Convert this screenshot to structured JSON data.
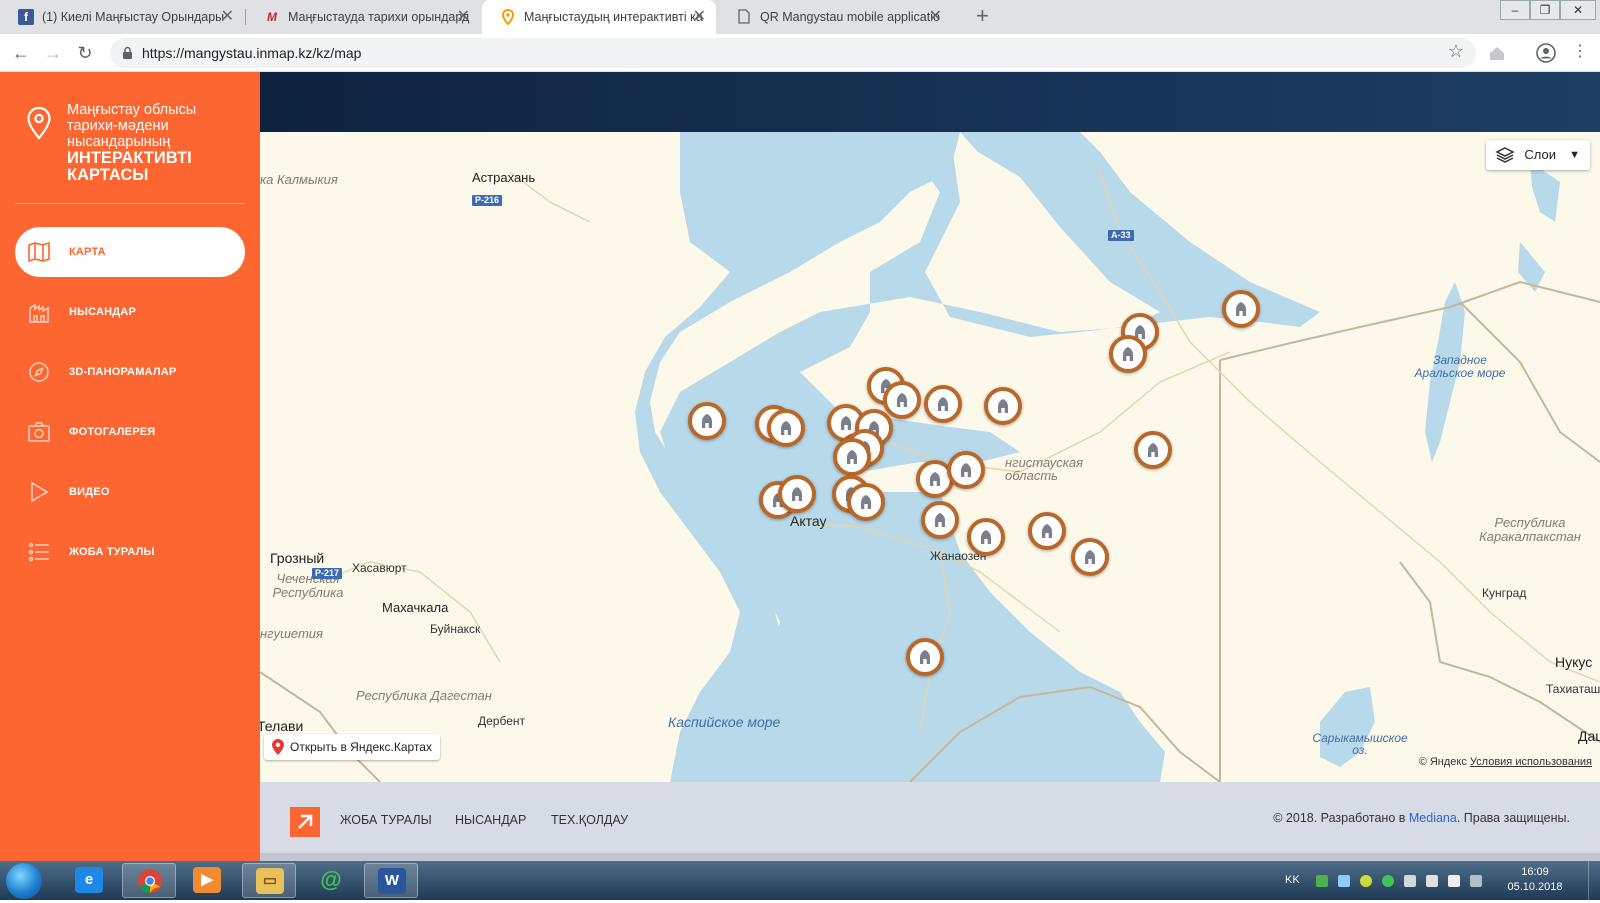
{
  "browser": {
    "tabs": [
      {
        "title": "(1) Киелі Маңғыстау Орындары",
        "favicon": "facebook-icon"
      },
      {
        "title": "Маңғыстауда тарихи орындард",
        "favicon": "m-logo-icon"
      },
      {
        "title": "Маңғыстаудың интерактивті ка",
        "favicon": "map-pin-icon"
      },
      {
        "title": "QR Mangystau mobile applicatio",
        "favicon": "document-icon"
      }
    ],
    "active_tab": 2,
    "url": "https://mangystau.inmap.kz/kz/map"
  },
  "sidebar": {
    "brand_lines": [
      "Маңғыстау облысы",
      "тарихи-мәдени",
      "нысандарының"
    ],
    "brand_strong": [
      "ИНТЕРАКТИВТІ",
      "КАРТАСЫ"
    ],
    "menu": [
      {
        "label": "КАРТА",
        "icon": "map-icon",
        "active": true
      },
      {
        "label": "НЫСАНДАР",
        "icon": "building-icon",
        "active": false
      },
      {
        "label": "3D-ПАНОРАМАЛАР",
        "icon": "compass-icon",
        "active": false
      },
      {
        "label": "ФОТОГАЛЕРЕЯ",
        "icon": "camera-icon",
        "active": false
      },
      {
        "label": "ВИДЕО",
        "icon": "play-icon",
        "active": false
      },
      {
        "label": "ЖОБА ТУРАЛЫ",
        "icon": "list-icon",
        "active": false
      }
    ]
  },
  "map": {
    "layers_label": "Слои",
    "open_yandex_label": "Открыть в Яндекс.Картах",
    "copyright": "© Яндекс",
    "terms_label": "Условия использования",
    "places": {
      "astrakhan": "Астрахань",
      "kalmykia": "ка Калмыкия",
      "grozny": "Грозный",
      "khasavyurt": "Хасавюрт",
      "chechnya": "Чеченская Республика",
      "makhachkala": "Махачкала",
      "buynaksk": "Буйнакск",
      "ingushetia": "нгушетия",
      "dagestan": "Республика Дагестан",
      "derbent": "Дербент",
      "telavi": "Телави",
      "caspian": "Каспийское море",
      "aktau": "Актау",
      "zhanaozen": "Жанаозен",
      "mangystau_region": "нгистауская область",
      "west_aral": "Западное Аральское море",
      "karakalpakstan": "Республика Каракалпакстан",
      "kungrad": "Кунград",
      "nukus": "Нукус",
      "takhiatash": "Тахиаташ",
      "sarykamysh": "Сарыкамышское оз.",
      "dash": "Даш"
    },
    "road_tags": [
      "Р-216",
      "А-33",
      "Р-217"
    ],
    "marker_count": 27
  },
  "footer": {
    "links": [
      "ЖОБА ТУРАЛЫ",
      "НЫСАНДАР",
      "ТЕХ.ҚОЛДАУ"
    ],
    "copy_pre": "© 2018. Разработано в",
    "copy_brand": "Mediana",
    "copy_post": ". Права защищены."
  },
  "taskbar": {
    "apps": [
      "internet-explorer-icon",
      "chrome-icon",
      "media-player-icon",
      "file-explorer-icon",
      "messenger-icon",
      "word-icon"
    ],
    "active_app": "chrome-icon",
    "lang": "KK",
    "time": "16:09",
    "date": "05.10.2018"
  },
  "colors": {
    "accent": "#fd6531",
    "marker_ring": "#b8692a",
    "water": "#b8d9ea",
    "land": "#fcf8ea",
    "header_dark": "#0f2340"
  }
}
